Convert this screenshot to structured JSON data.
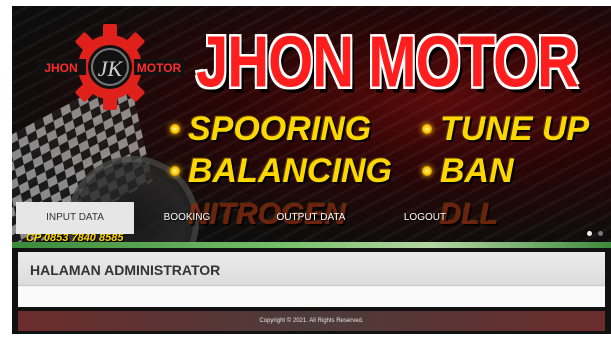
{
  "banner": {
    "logo_text_left": "JHON",
    "logo_monogram": "JK",
    "logo_text_right": "MOTOR",
    "brand_title": "JHON MOTOR",
    "services": [
      "SPOORING",
      "TUNE UP",
      "BALANCING",
      "BAN",
      "NITROGEN",
      "DLL"
    ],
    "phone": "CP 0853 7840 8585"
  },
  "nav": {
    "items": [
      {
        "label": "INPUT DATA",
        "active": true
      },
      {
        "label": "BOOKING",
        "active": false
      },
      {
        "label": "OUTPUT DATA",
        "active": false
      },
      {
        "label": "LOGOUT",
        "active": false
      }
    ]
  },
  "slider": {
    "dot_count": 2,
    "active_index": 0
  },
  "content": {
    "page_title": "HALAMAN ADMINISTRATOR"
  },
  "footer": {
    "copyright": "Copyright © 2021. All Rights Reserved."
  },
  "colors": {
    "brand_red": "#ff1e1e",
    "service_yellow": "#ffd700",
    "footer_bg": "#6b2c2c",
    "active_tab_bg": "#e6e6e6"
  },
  "icons": [
    "gear-logo-icon",
    "checkered-flag-icon",
    "speedometer-icon"
  ]
}
